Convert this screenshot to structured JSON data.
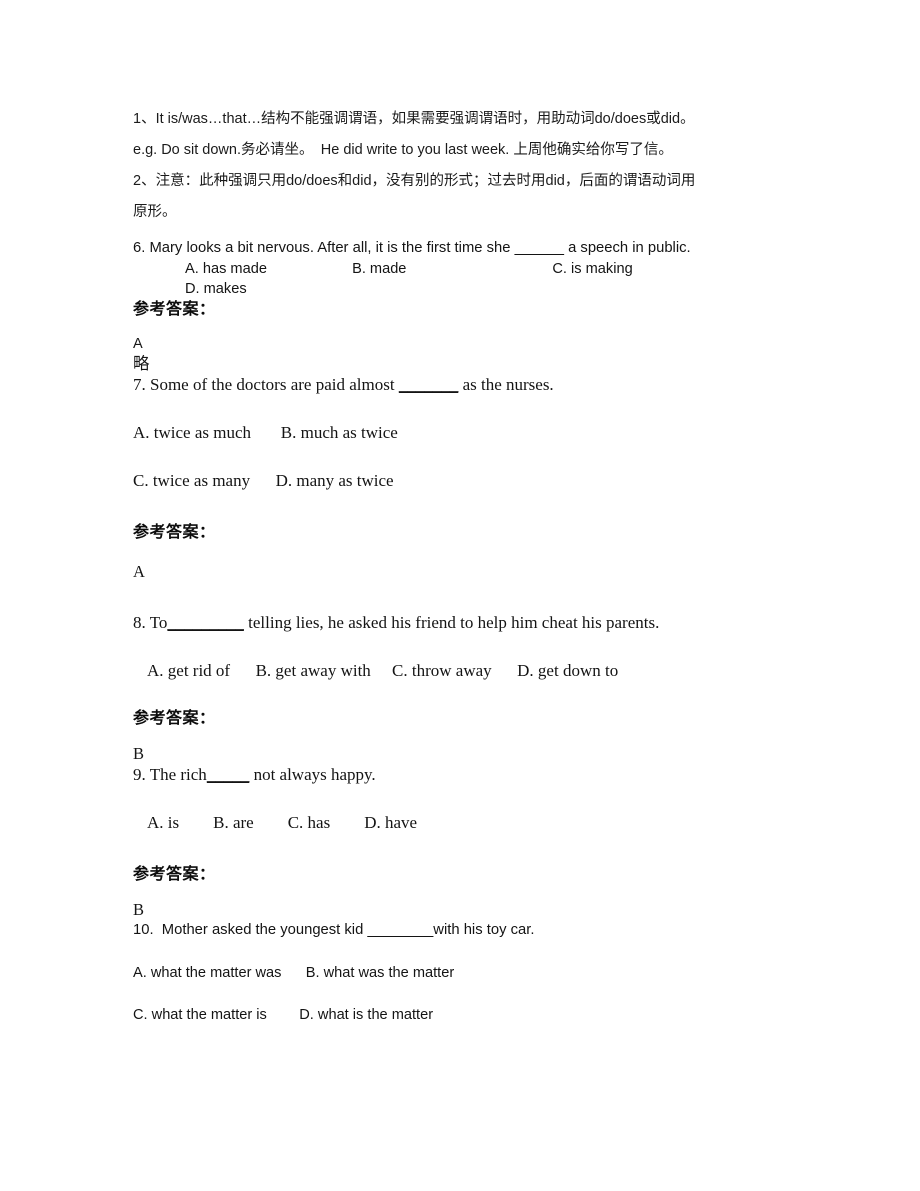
{
  "document": {
    "notes": [
      "1、It is/was…that…结构不能强调谓语，如果需要强调谓语时，用助动词do/does或did。",
      "e.g. Do sit down.务必请坐。　He did write to you last week. 上周他确实给你写了信。",
      "2、注意：此种强调只用do/does和did，没有别的形式；过去时用did，后面的谓语动词用",
      "原形。"
    ],
    "answer_heading": "参考答案：",
    "questions": [
      {
        "number": "6.",
        "stem_before": "6. Mary looks a bit nervous. After all, it is the first time she ",
        "blank": "______",
        "stem_after": " a speech in public.",
        "options_row1": "A. has made                     B. made                                    C. is making",
        "options_row2": "D. makes",
        "answer": "A",
        "answer_extra": "略"
      },
      {
        "number": "7.",
        "stem_before": "7. Some of the doctors are paid almost ",
        "blank": "_______",
        "stem_after": " as the nurses.",
        "options_row1": "A. twice as much       B. much as twice",
        "options_row2": "C. twice as many      D. many as twice",
        "answer": "A",
        "answer_extra": ""
      },
      {
        "number": "8.",
        "stem_before": "8. To",
        "blank": "_________",
        "stem_after": " telling lies, he asked his friend to help him cheat his parents.",
        "options_row1": "A. get rid of      B. get away with     C. throw away      D. get down to",
        "options_row2": "",
        "answer": "B",
        "answer_extra": ""
      },
      {
        "number": "9.",
        "stem_before": "9. The rich",
        "blank": "_____",
        "stem_after": " not always happy.",
        "options_row1": "A. is        B. are        C. has        D. have",
        "options_row2": "",
        "answer": "B",
        "answer_extra": ""
      },
      {
        "number": "10.",
        "stem_before": "10.  Mother asked the youngest kid ",
        "blank": "________",
        "stem_after": "with his toy car.",
        "options_row1": "A. what the matter was      B. what was the matter",
        "options_row2": "C. what the matter is        D. what is the matter",
        "answer": "",
        "answer_extra": ""
      }
    ]
  }
}
